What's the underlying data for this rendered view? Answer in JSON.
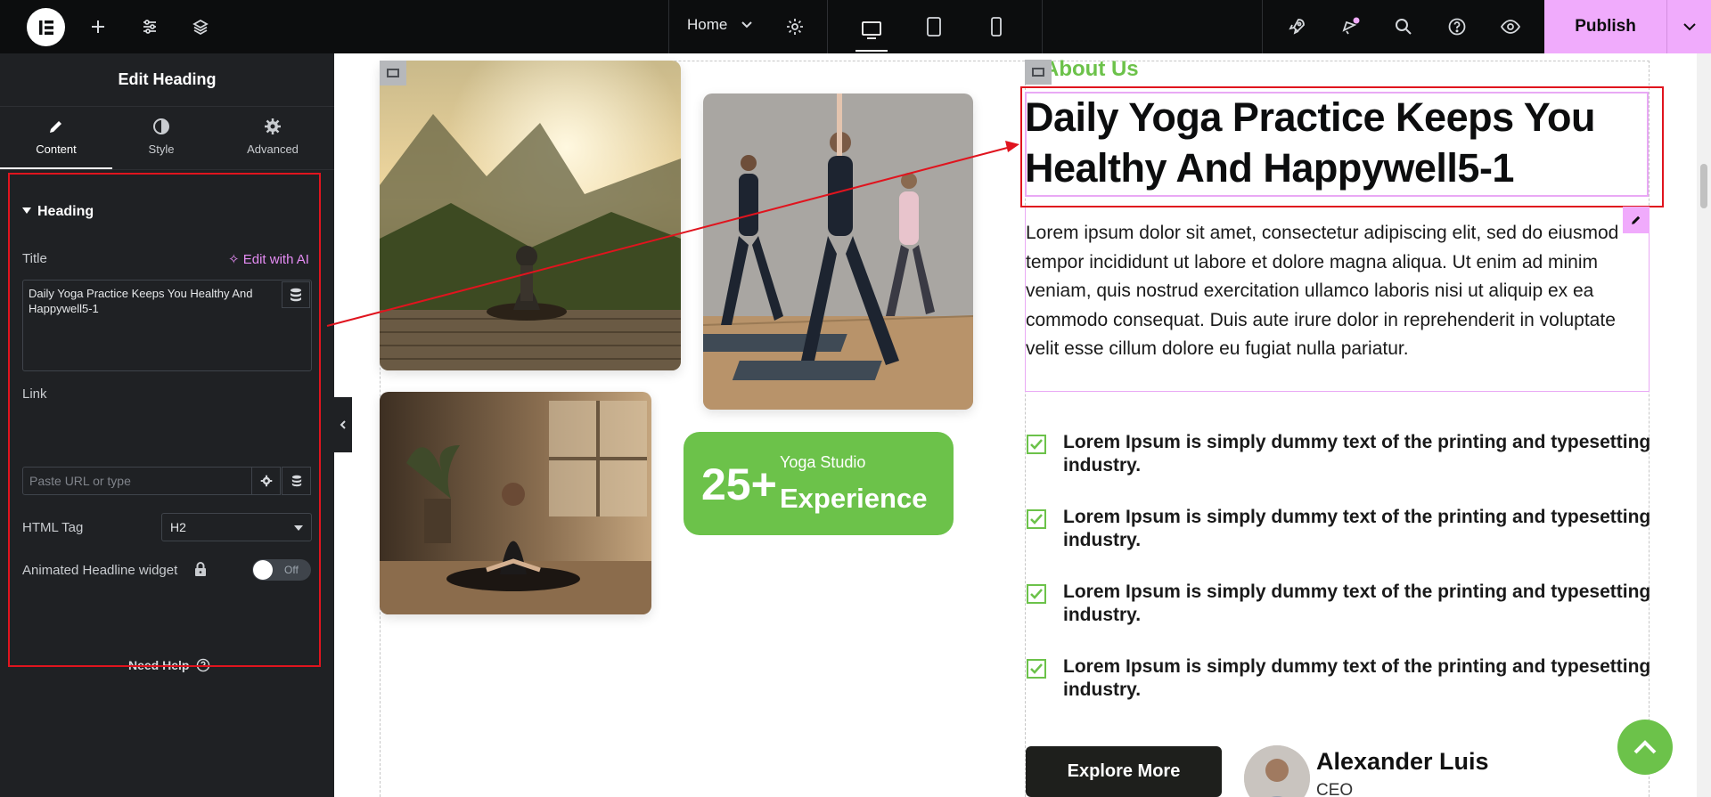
{
  "topbar": {
    "page_name": "Home",
    "publish_label": "Publish",
    "icons": [
      "elementor-logo-icon",
      "add-icon",
      "settings-sliders-icon",
      "layers-icon",
      "chevron-down-icon",
      "gear-icon",
      "desktop-icon",
      "tablet-icon",
      "mobile-icon",
      "rocket-icon",
      "notifications-icon",
      "search-icon",
      "help-icon",
      "preview-eye-icon"
    ]
  },
  "panel": {
    "title": "Edit Heading",
    "tabs": [
      {
        "label": "Content",
        "icon": "pencil-icon",
        "active": true
      },
      {
        "label": "Style",
        "icon": "contrast-icon",
        "active": false
      },
      {
        "label": "Advanced",
        "icon": "gear-icon",
        "active": false
      }
    ],
    "section_title": "Heading",
    "title_label": "Title",
    "edit_with_ai": "Edit with AI",
    "title_value": "Daily Yoga Practice Keeps You Healthy And Happywell5-1",
    "link_label": "Link",
    "link_placeholder": "Paste URL or type",
    "html_tag_label": "HTML Tag",
    "html_tag_value": "H2",
    "animated_label": "Animated Headline widget",
    "toggle_label": "Off",
    "need_help": "Need Help"
  },
  "content": {
    "about_label": "About Us",
    "heading": "Daily Yoga Practice Keeps You Healthy And Happywell5-1",
    "paragraph": "Lorem ipsum dolor sit amet, consectetur adipiscing elit, sed do eiusmod tempor incididunt ut labore et dolore magna aliqua. Ut enim ad minim veniam, quis nostrud exercitation ullamco laboris nisi ut aliquip ex ea commodo consequat. Duis aute irure dolor in reprehenderit in voluptate velit esse cillum dolore eu fugiat nulla pariatur.",
    "checklist": [
      "Lorem Ipsum is simply dummy text of the printing and typesetting industry.",
      "Lorem Ipsum is simply dummy text of the printing and typesetting industry.",
      "Lorem Ipsum is simply dummy text of the printing and typesetting industry.",
      "Lorem Ipsum is simply dummy text of the printing and typesetting industry."
    ],
    "badge": {
      "number": "25+",
      "line1": "Yoga Studio",
      "line2": "Experience"
    },
    "explore_button": "Explore More",
    "person_name": "Alexander Luis",
    "person_role": "CEO"
  },
  "colors": {
    "accent_green": "#6cc24a",
    "publish_pink": "#f0abfc",
    "panel_bg": "#1f2124",
    "annotation_red": "#e0141e"
  }
}
